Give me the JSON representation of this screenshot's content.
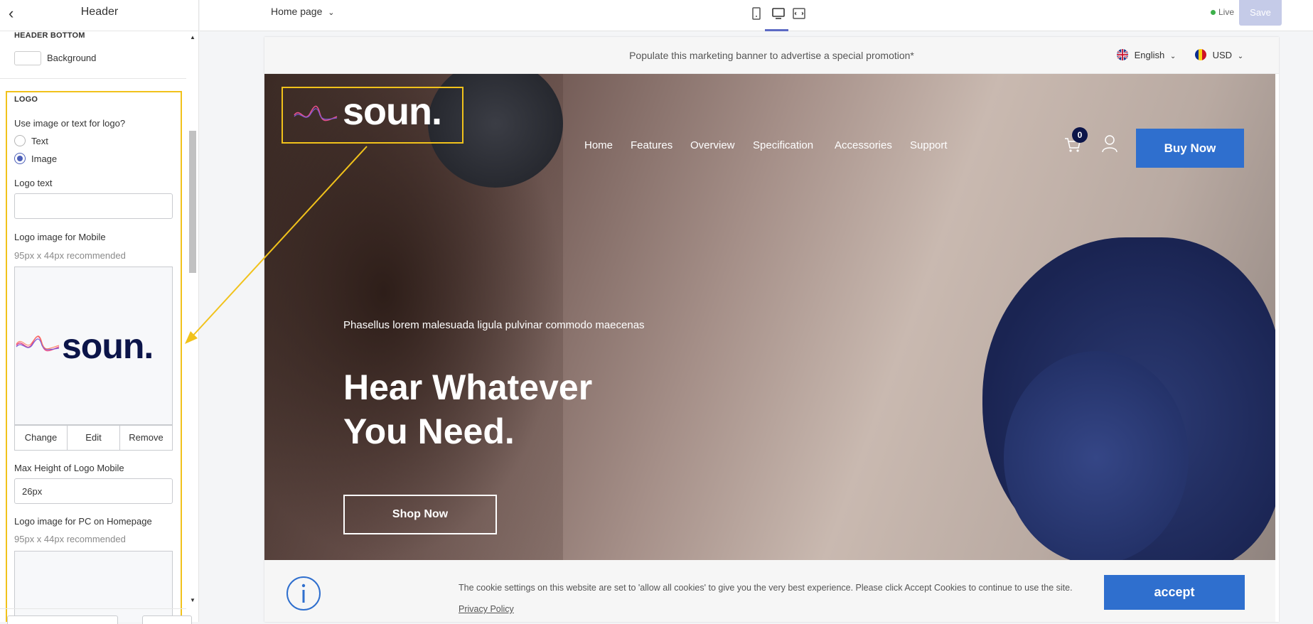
{
  "sidebar": {
    "title": "Header",
    "header_bottom": {
      "section_title": "HEADER BOTTOM",
      "background_label": "Background"
    },
    "logo": {
      "section_title": "LOGO",
      "question": "Use image or text for logo?",
      "options": [
        "Text",
        "Image"
      ],
      "selected": "Image",
      "logo_text_label": "Logo text",
      "logo_text_value": "",
      "mobile_image_label": "Logo image for Mobile",
      "mobile_image_hint": "95px x 44px recommended",
      "logo_wordmark": "soun.",
      "image_buttons": [
        "Change",
        "Edit",
        "Remove"
      ],
      "max_height_label": "Max Height of Logo Mobile",
      "max_height_value": "26px",
      "pc_image_label": "Logo image for PC on Homepage",
      "pc_image_hint": "95px x 44px recommended"
    }
  },
  "topbar": {
    "page_select": "Home page",
    "devices": [
      "mobile-icon",
      "desktop-icon",
      "fullwidth-icon"
    ],
    "active_device": "desktop",
    "status": "Live",
    "save_label": "Save"
  },
  "preview": {
    "promo_banner": "Populate this marketing banner to advertise a special promotion*",
    "language": "English",
    "currency": "USD",
    "logo": "soun.",
    "nav": [
      "Home",
      "Features",
      "Overview",
      "Specification",
      "Accessories",
      "Support"
    ],
    "cart_count": "0",
    "buy_label": "Buy Now",
    "hero_subtitle": "Phasellus lorem malesuada ligula pulvinar commodo maecenas",
    "hero_title_line1": "Hear Whatever",
    "hero_title_line2": "You Need.",
    "shop_label": "Shop Now",
    "cookie_text": "The cookie settings on this website are set to 'allow all cookies' to give you the very best experience. Please click Accept Cookies to continue to use the site.",
    "privacy_label": "Privacy Policy",
    "accept_label": "accept"
  },
  "colors": {
    "accent": "#2f6fce",
    "highlight": "#f1c21b",
    "radio": "#4c5fb8",
    "brand_navy": "#0c1549"
  }
}
